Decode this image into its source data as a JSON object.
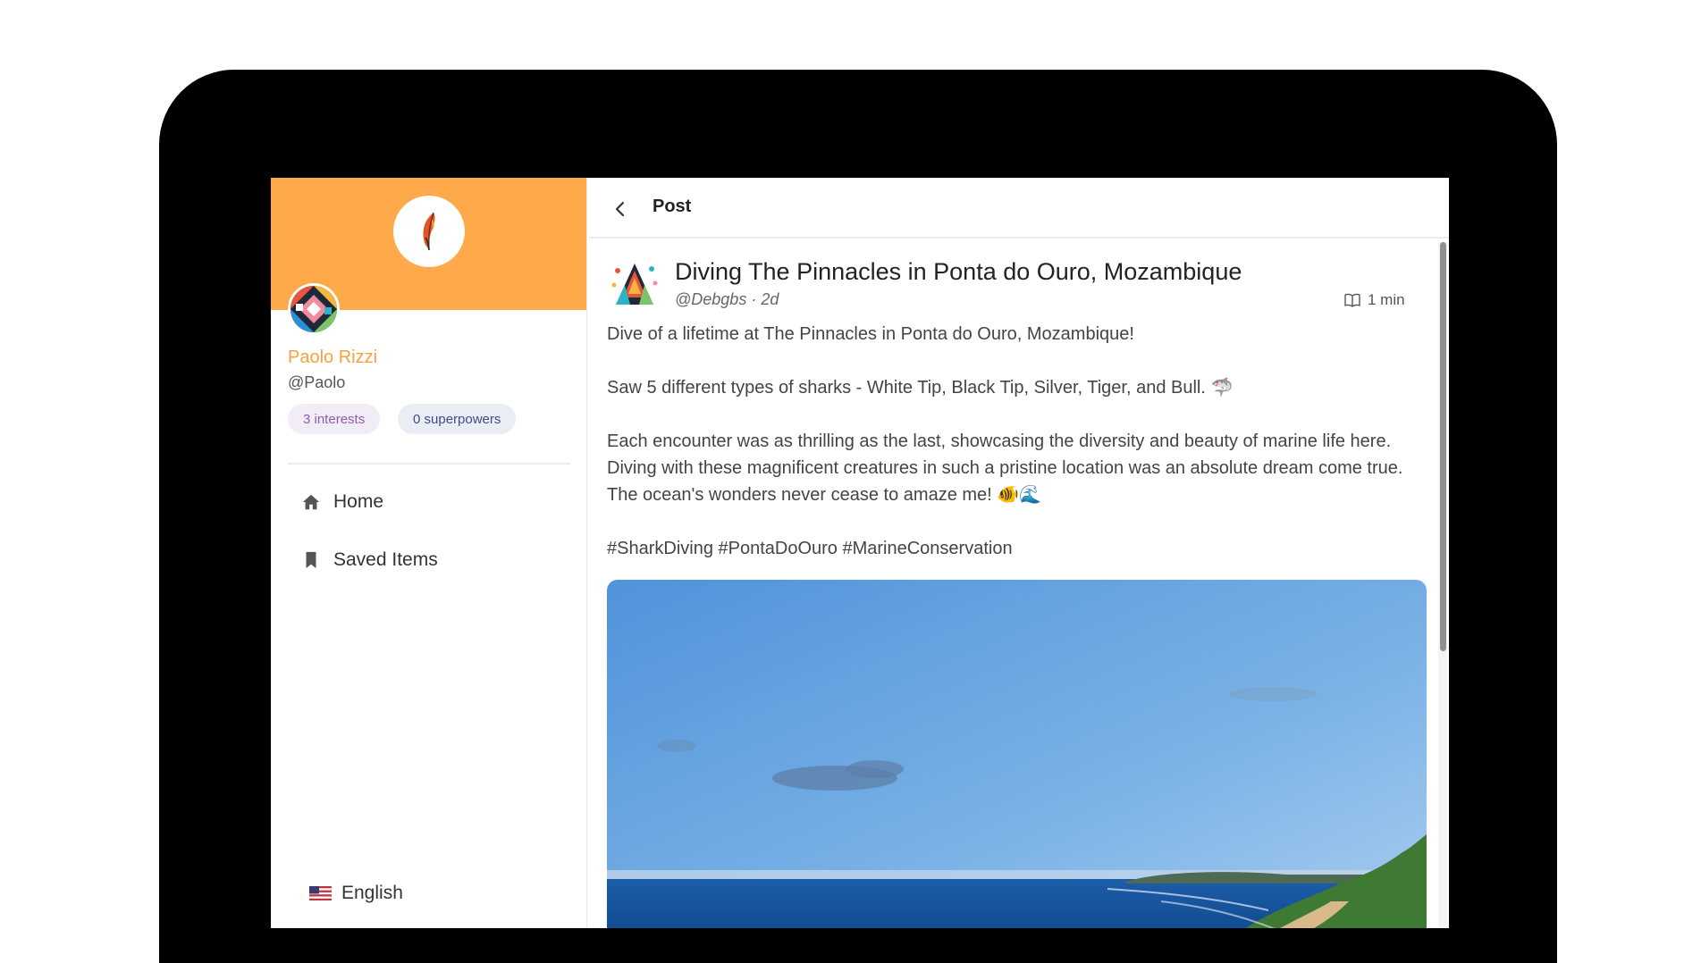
{
  "sidebar": {
    "profile": {
      "name": "Paolo Rizzi",
      "handle": "@Paolo",
      "interests": "3 interests",
      "superpowers": "0 superpowers"
    },
    "nav": {
      "home": "Home",
      "saved": "Saved Items"
    },
    "language": "English"
  },
  "header": {
    "title": "Post"
  },
  "post": {
    "title": "Diving The Pinnacles in Ponta do Ouro, Mozambique",
    "author": "@Debgbs",
    "age": "· 2d",
    "read_time": "1 min",
    "paragraphs": [
      "Dive of a lifetime at The Pinnacles in Ponta do Ouro, Mozambique!",
      "Saw 5 different types of sharks - White Tip, Black Tip, Silver, Tiger, and Bull. 🦈",
      "Each encounter was as thrilling as the last, showcasing the diversity and beauty of marine life here. Diving with these magnificent creatures in such a pristine location was an absolute dream come true. The ocean's wonders never cease to amaze me! 🐠🌊",
      "#SharkDiving #PontaDoOuro #MarineConservation"
    ]
  },
  "colors": {
    "cover": "#FFAA4A",
    "accent": "#F4A23E",
    "interests_pill_bg": "#F1ECF6",
    "superpowers_pill_bg": "#EBEDF5"
  },
  "icons": {
    "back": "chevron-left-icon",
    "home": "home-icon",
    "saved": "bookmark-icon",
    "read_time": "book-open-icon",
    "language": "us-flag-icon",
    "logo": "feather-icon"
  }
}
